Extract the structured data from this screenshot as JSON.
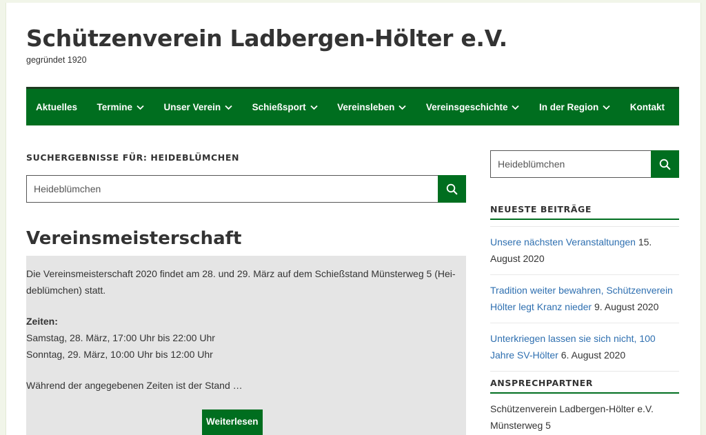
{
  "site": {
    "title": "Schützenverein Ladbergen-Hölter e.V.",
    "tagline": "gegründet 1920"
  },
  "nav": [
    {
      "label": "Aktuelles",
      "dropdown": false
    },
    {
      "label": "Termine",
      "dropdown": true
    },
    {
      "label": "Unser Verein",
      "dropdown": true
    },
    {
      "label": "Schießsport",
      "dropdown": true
    },
    {
      "label": "Vereinsleben",
      "dropdown": true
    },
    {
      "label": "Vereinsgeschichte",
      "dropdown": true
    },
    {
      "label": "In der Region",
      "dropdown": true
    },
    {
      "label": "Kontakt",
      "dropdown": false
    }
  ],
  "main": {
    "results_heading": "SUCHERGEBNISSE FÜR: HEIDEBLÜMCHEN",
    "search_value": "Heideblümchen",
    "post": {
      "title": "Vereinsmeisterschaft",
      "para1": "Die Vereinsmeisterschaft 2020 findet am 28. und 29. März auf dem Schießstand Münsterweg 5 (Hei­deblümchen) statt.",
      "times_label": "Zeiten:",
      "time1": "Samstag, 28. März, 17:00 Uhr bis 22:00 Uhr",
      "time2": "Sonntag, 29. März, 10:00 Uhr bis 12:00 Uhr",
      "para3": "Während der angegebenen Zeiten ist der Stand …",
      "more_label": "Weiterlesen"
    }
  },
  "sidebar": {
    "search_value": "Heideblümchen",
    "recent_title": "NEUESTE BEITRÄGE",
    "recent": [
      {
        "title": "Unsere nächsten Veranstaltungen",
        "date": "15. August 2020"
      },
      {
        "title": "Tradition weiter bewahren, Schützenverein Hölter legt Kranz nieder",
        "date": "9. August 2020"
      },
      {
        "title": "Unterkriegen lassen sie sich nicht, 100 Jahre SV-Hölter",
        "date": "6. August 2020"
      }
    ],
    "contact_title": "ANSPRECHPARTNER",
    "contact_line1": "Schützenverein Ladbergen-Hölter e.V.",
    "contact_line2": "Münsterweg 5"
  },
  "icons": {
    "search": "search-icon",
    "dropdown": "chevron-down-icon"
  },
  "colors": {
    "brand_green": "#006e1f",
    "link_blue": "#2e6fb0",
    "excerpt_bg": "#e5e5e5"
  }
}
